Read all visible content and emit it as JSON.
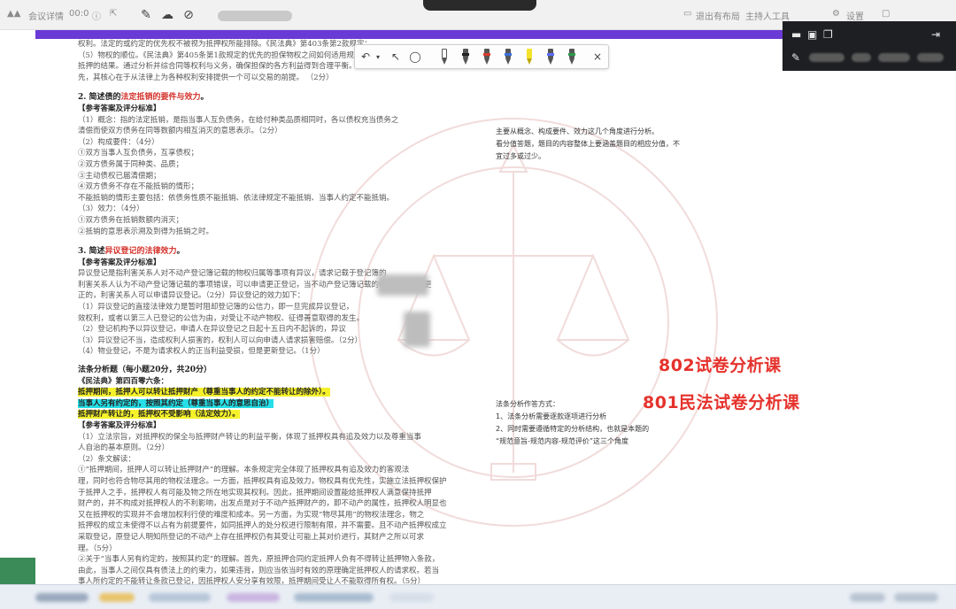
{
  "topbar": {
    "left_items": [
      "会议详情",
      "00:0",
      ""
    ],
    "right_items": [
      "退出有布局",
      "主持人工具",
      "设置"
    ]
  },
  "annotation_toolbar": {
    "tools": [
      "undo-icon",
      "chevron-down-icon",
      "pointer-icon",
      "lasso-icon",
      "eraser-icon"
    ],
    "pen_colors": [
      "#222222",
      "#222222",
      "#d73a2c",
      "#3a6fd8",
      "#f4e12b",
      "#5a6cff",
      "#2a9a4b"
    ],
    "close_label": "×"
  },
  "slide": {
    "intro_lines": [
      "权利。法定的或约定的优先权不被视为抵押权所能排除。《民法典》第403条第2款规定：",
      "（5）物权的顺位。《民法典》第405条第1款规定的优先的担保物权之间如何适用规则。",
      "抵押的结果。通过分析并综合同等权利与义务，确保担保的各方利益得到合理平衡。",
      "先，其核心在于从法律上为各种权利安排提供一个可以交易的前提。                 （2分）"
    ],
    "q2_title_prefix": "2. 简述债的",
    "q2_title_red": "法定抵销的要件与效力",
    "q2_title_suffix": "。",
    "q2_answer_head": "【参考答案及评分标准】",
    "q2_lines": [
      "（1）概念：指的法定抵销，是指当事人互负债务，在给付种类品质相同时，各以债权充当债务之",
      "清偿而使双方债务在同等数额内相互消灭的意思表示。（2分）",
      "（2）构成要件：（4分）",
      "①双方当事人互负债务，互享债权；",
      "②双方债务属于同种类、品质；",
      "③主动债权已届清偿期；",
      "④双方债务不存在不能抵销的情形；",
      "不能抵销的情形主要包括：依债务性质不能抵销、依法律规定不能抵销、当事人约定不能抵销。",
      "（3）效力：（4分）",
      "①双方债务在抵销数额内消灭；",
      "②抵销的意思表示溯及到得为抵销之时。"
    ],
    "q3_title_prefix": "3. 简述",
    "q3_title_red": "异议登记的法律效力",
    "q3_title_suffix": "。",
    "q3_answer_head": "【参考答案及评分标准】",
    "q3_lines": [
      "异议登记是指利害关系人对不动产登记簿记载的物权归属等事项有异议，请求记载于登记簿的",
      "利害关系人认为不动产登记簿记载的事项错误，可以申请更正登记，当不动产登记簿记载的权利人不同意更",
      "正的，利害关系人可以申请异议登记。（2分）异议登记的效力如下：",
      "（1）异议登记的直接法律效力是暂时阻却登记簿的公信力，即一旦完成异议登记，",
      "效权利，或者以第三人已登记的公信为由，对受让不动产物权、征得善意取得的发生。",
      "（2）登记机构予以异议登记，申请人在异议登记之日起十五日内不起诉的，异议",
      "（3）异议登记不当，造成权利人损害的，权利人可以向申请人请求损害赔偿。（2分）",
      "（4）物业登记，不是为请求权人的正当利益受损，但是更新登记。（1分）"
    ],
    "q4_title": "法条分析题（每小题20分，共20分）",
    "q4_source": "《民法典》第四百零六条：",
    "q4_hl_yellow_1": "抵押期间，抵押人可以转让抵押财产（尊重当事人的约定不能转让的除外）。",
    "q4_hl_cyan": "当事人另有约定的，按照其约定（尊重当事人的意思自治）",
    "q4_hl_yellow_2": "抵押财产转让的，抵押权不受影响（法定效力）。",
    "q4_answer_head": "【参考答案及评分标准】",
    "q4_lines": [
      "（1）立法宗旨，对抵押权的保全与抵押财产转让的利益平衡，体现了抵押权具有追及效力以及尊重当事",
      "人自治的基本原则。（2分）",
      "（2）条文解读：",
      "①“抵押期间，抵押人可以转让抵押财产”的理解。本条规定完全体现了抵押权具有追及效力的客观法",
      "理，同时也符合物尽其用的物权法理念。一方面，抵押权具有追及效力，物权具有优先性，实施立法抵押权保护",
      "于抵押人之手，抵押权人有可能及物之所在地实现其权利。因此，抵押期间设置能给抵押权人满意保持抵押",
      "财产的，并不构成对抵押权人的不利影响，出发点是对于不动产抵押财产的，即不动产的属性，抵押权人明显也",
      "又在抵押权的实现并不会增加权利行使的难度和成本。另一方面，为实现“物尽其用”的物权法理念，物之",
      "抵押权的成立未使得不以占有为前提要件，如同抵押人的处分权进行限制有限，并不需要。且不动产抵押权成立",
      "采取登记，原登记人明知所登记的不动产上存在抵押权仍有其受让可能上其对价进行，其财产之所以可求",
      "理。（5分）",
      "②关于“当事人另有约定的，按照其约定”的理解。首先，原抵押合同约定抵押人负有不得转让抵押物入条款，",
      "由此，当事人之间仅具有债法上的约束力，如果违背，则应当依当时有效的原理确定抵押权人的请求权。若当",
      "事人所约定的不能转让条款已登记，因抵押权人安分享有效限，抵押期间受让人不能取得所有权。（5分）"
    ],
    "right_note_1": [
      "主要从概念、构成要件、效力这几个角度进行分析。",
      "看分值答题，题目的内容整体上要涵盖题目的相应分值，不",
      "宜过多或过少。"
    ],
    "right_note_2_title": "法条分析作答方式：",
    "right_note_2": [
      "1、法条分析需要逐款逐项进行分析",
      "2、同时需要遵循特定的分析结构，也就是本题的",
      "“规范意旨-规范内容-规范评价”这三个角度"
    ],
    "big_label_1": "802试卷分析课",
    "big_label_2": "801民法试卷分析课"
  },
  "dark_panel": {
    "icons": [
      "minimize-icon",
      "window-icon",
      "restore-icon",
      "exit-icon",
      "pin-icon"
    ]
  },
  "colors": {
    "purple": "#6a3ad6",
    "red_label": "#e5322c",
    "highlight_yellow": "#f6f22a",
    "highlight_cyan": "#25e0e8"
  }
}
